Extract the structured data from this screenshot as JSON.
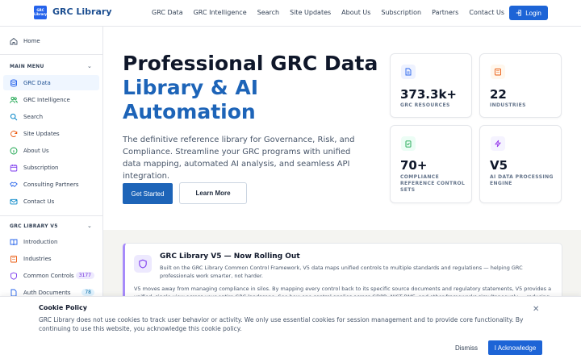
{
  "header": {
    "logo_text": "GRC Library",
    "brand": "GRC Library",
    "nav": [
      "GRC Data",
      "GRC Intelligence",
      "Search",
      "Site Updates",
      "About Us",
      "Subscription",
      "Partners",
      "Contact Us"
    ],
    "login_label": "Login"
  },
  "sidebar": {
    "home": "Home",
    "main_menu_heading": "MAIN MENU",
    "main_items": [
      {
        "label": "GRC Data",
        "icon": "database-icon",
        "active": true
      },
      {
        "label": "GRC Intelligence",
        "icon": "users-icon"
      },
      {
        "label": "Search",
        "icon": "search-icon"
      },
      {
        "label": "Site Updates",
        "icon": "refresh-icon"
      },
      {
        "label": "About Us",
        "icon": "info-icon"
      },
      {
        "label": "Subscription",
        "icon": "calendar-icon"
      },
      {
        "label": "Consulting Partners",
        "icon": "handshake-icon"
      },
      {
        "label": "Contact Us",
        "icon": "mail-icon"
      }
    ],
    "library_heading": "GRC LIBRARY V5",
    "library_items": [
      {
        "label": "Introduction",
        "icon": "book-icon"
      },
      {
        "label": "Industries",
        "icon": "building-icon"
      },
      {
        "label": "Common Controls",
        "icon": "shield-icon",
        "badge": "3177"
      },
      {
        "label": "Auth Documents",
        "icon": "document-icon",
        "badge": "78"
      }
    ]
  },
  "hero": {
    "title_line1": "Professional GRC Data",
    "title_line2": "Library & AI",
    "title_line3": "Automation",
    "description": "The definitive reference library for Governance, Risk, and Compliance. Streamline your GRC programs with unified data mapping, automated AI analysis, and seamless API integration.",
    "primary_cta": "Get Started",
    "secondary_cta": "Learn More"
  },
  "stats": [
    {
      "value": "373.3k+",
      "label": "GRC RESOURCES",
      "icon": "document-icon",
      "color": "#eef2ff"
    },
    {
      "value": "22",
      "label": "INDUSTRIES",
      "icon": "building-icon",
      "color": "#fff7ed"
    },
    {
      "value": "70+",
      "label": "COMPLIANCE REFERENCE CONTROL SETS",
      "icon": "clipboard-check-icon",
      "color": "#ecfdf5"
    },
    {
      "value": "V5",
      "label": "AI DATA PROCESSING ENGINE",
      "icon": "lightning-icon",
      "color": "#f5f3ff"
    }
  ],
  "announcement": {
    "title": "GRC Library V5 — Now Rolling Out",
    "subtitle": "Built on the GRC Library Common Control Framework, V5 data maps unified controls to multiple standards and regulations — helping GRC professionals work smarter, not harder.",
    "body": "V5 moves away from managing compliance in silos. By mapping every control back to its specific source documents and regulatory statements, V5 provides a unified, single view across your entire GRC landscape. See how one control applies across GDPR, NIST RMF, and other frameworks simultaneously — reducing"
  },
  "cookie": {
    "title": "Cookie Policy",
    "text": "GRC Library does not use cookies to track user behavior or activity. We only use essential cookies for session management and to provide core functionality. By continuing to use this website, you acknowledge this cookie policy.",
    "dismiss": "Dismiss",
    "acknowledge": "I Acknowledge"
  }
}
